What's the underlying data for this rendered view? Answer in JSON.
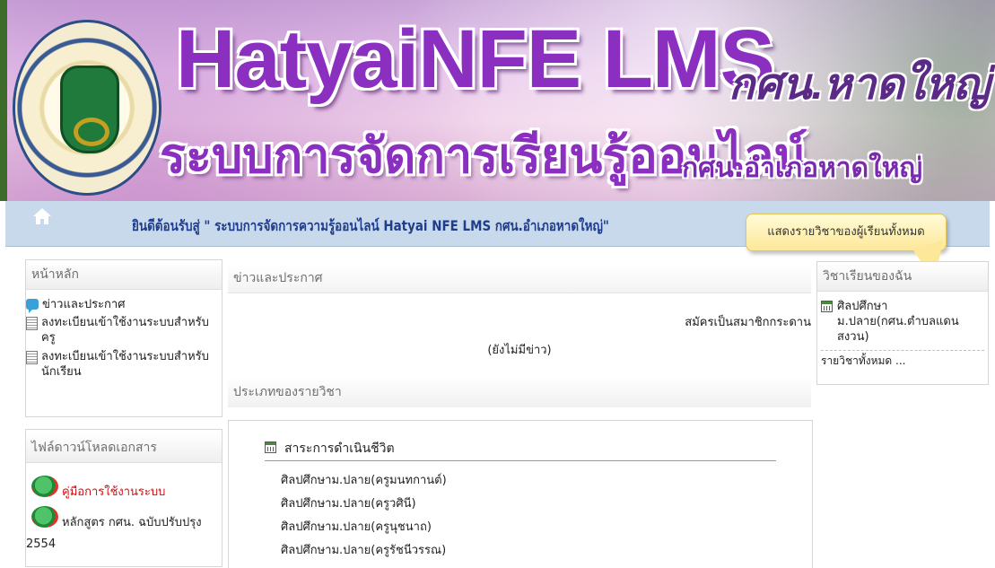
{
  "banner": {
    "title": "HatyaiNFE LMS",
    "title_right": "กศน.หาดใหญ่",
    "subtitle": "ระบบการจัดการเรียนรู้ออนไลน์",
    "subtitle_right": "กศน.อำเภอหาดใหญ่"
  },
  "navbar": {
    "welcome": "ยินดีต้อนรับสู่ \" ระบบการจัดการความรู้ออนไลน์ Hatyai NFE LMS กศน.อำเภอหาดใหญ่\""
  },
  "tooltip": {
    "text": "แสดงรายวิชาของผู้เรียนทั้งหมด"
  },
  "main_menu": {
    "heading": "หน้าหลัก",
    "items": [
      {
        "label": "ข่าวและประกาศ",
        "icon": "news-icon"
      },
      {
        "label": "ลงทะเบียนเข้าใช้งานระบบสำหรับครู",
        "icon": "document-icon"
      },
      {
        "label": "ลงทะเบียนเข้าใช้งานระบบสำหรับนักเรียน",
        "icon": "document-icon"
      }
    ]
  },
  "downloads": {
    "heading": "ไฟล์ดาวน์โหลดเอกสาร",
    "items": [
      {
        "label": "คู่มือการใช้งานระบบ",
        "color": "#d41010"
      },
      {
        "label": "หลักสูตร กศน. ฉบับปรับปรุง 2554",
        "color": "#222222"
      }
    ]
  },
  "news": {
    "heading": "ข่าวและประกาศ",
    "signup_link": "สมัครเป็นสมาชิกกระดาน",
    "empty": "(ยังไม่มีข่าว)"
  },
  "categories": {
    "heading": "ประเภทของรายวิชา",
    "category_title": "สาระการดำเนินชีวิต",
    "courses": [
      "ศิลปศึกษาม.ปลาย(ครูมนทกานต์)",
      "ศิลปศึกษาม.ปลาย(ครูวศินี)",
      "ศิลปศึกษาม.ปลาย(ครูนุชนาถ)",
      "ศิลปศึกษาม.ปลาย(ครูรัชนีวรรณ)"
    ]
  },
  "my_courses": {
    "heading": "วิชาเรียนของฉัน",
    "course": "ศิลปศึกษาม.ปลาย(กศน.ตำบลแดนสงวน)",
    "all_link": "รายวิชาทั้งหมด ..."
  }
}
